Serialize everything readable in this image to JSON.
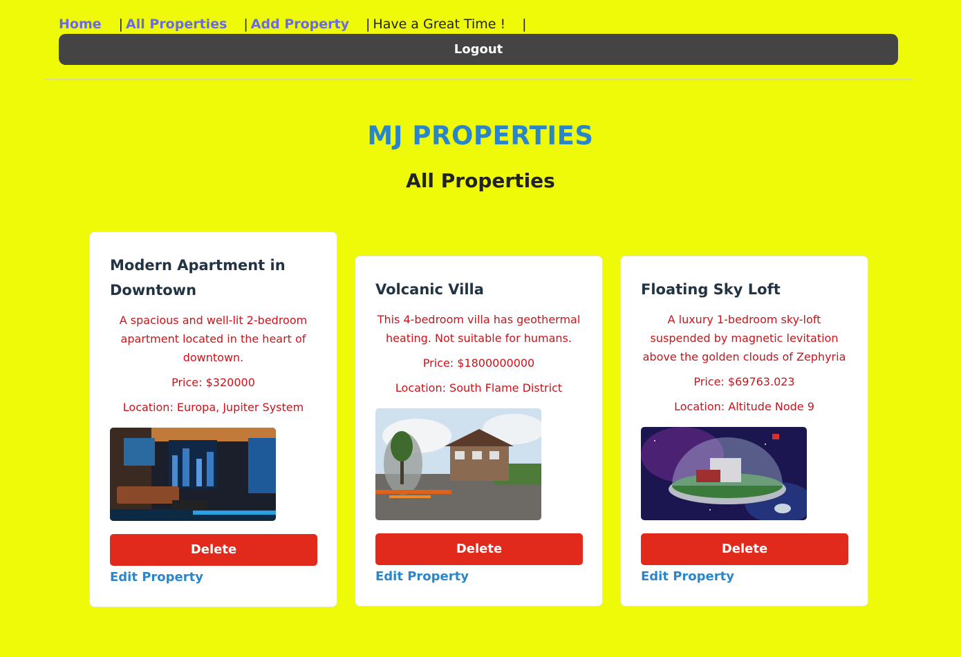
{
  "nav": {
    "home": "Home",
    "all_properties": "All Properties",
    "add_property": "Add Property",
    "greeting": "Have a Great Time !",
    "separator": "|"
  },
  "logout_label": "Logout",
  "brand": "MJ PROPERTIES",
  "page_title": "All Properties",
  "colors": {
    "background": "#eefa07",
    "brand": "#2a86c9",
    "delete": "#e12a1c",
    "description": "#c8141a"
  },
  "properties": [
    {
      "title": "Modern Apartment in Downtown",
      "description": "A spacious and well-lit 2-bedroom apartment located in the heart of downtown.",
      "price": "Price: $320000",
      "location": "Location: Europa, Jupiter System",
      "delete_label": "Delete",
      "edit_label": "Edit Property"
    },
    {
      "title": "Volcanic Villa",
      "description": "This 4-bedroom villa has geothermal heating. Not suitable for humans.",
      "price": "Price: $1800000000",
      "location": "Location: South Flame District",
      "delete_label": "Delete",
      "edit_label": "Edit Property"
    },
    {
      "title": "Floating Sky Loft",
      "description": "A luxury 1-bedroom sky-loft suspended by magnetic levitation above the golden clouds of Zephyria",
      "price": "Price: $69763.023",
      "location": "Location: Altitude Node 9",
      "delete_label": "Delete",
      "edit_label": "Edit Property"
    }
  ]
}
